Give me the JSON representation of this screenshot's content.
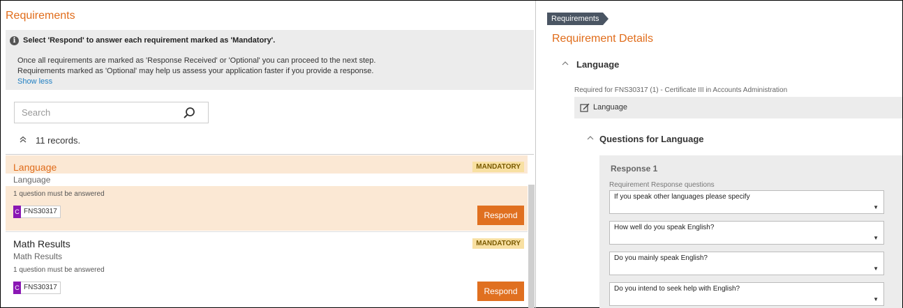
{
  "left": {
    "title": "Requirements",
    "info": {
      "heading": "Select 'Respond' to answer each requirement marked as 'Mandatory'.",
      "line1": "Once all requirements are marked as 'Response Received' or 'Optional' you can proceed to the next step.",
      "line2": "Requirements marked as 'Optional' may help us assess your application faster if you provide a response.",
      "show_less": "Show less"
    },
    "search": {
      "placeholder": "Search",
      "value": ""
    },
    "records": "11 records.",
    "items": [
      {
        "title": "Language",
        "subtitle": "Language",
        "note": "1 question must be answered",
        "badge": "MANDATORY",
        "tag_letter": "C",
        "tag_code": "FNS30317",
        "action": "Respond"
      },
      {
        "title": "Math Results",
        "subtitle": "Math Results",
        "note": "1 question must be answered",
        "badge": "MANDATORY",
        "tag_letter": "C",
        "tag_code": "FNS30317",
        "action": "Respond"
      }
    ]
  },
  "right": {
    "breadcrumb": "Requirements",
    "title": "Requirement Details",
    "section": "Language",
    "required_for": "Required for FNS30317 (1) - Certificate III in Accounts Administration",
    "language_item": "Language",
    "questions_title": "Questions for Language",
    "response_title": "Response 1",
    "response_sub": "Requirement Response questions",
    "questions": [
      "If you speak other languages please specify",
      "How well do you speak English?",
      "Do you mainly speak English?",
      "Do you intend to seek help with English?"
    ]
  },
  "colors": {
    "accent_orange": "#e06c1a",
    "button_orange": "#e07020",
    "badge_bg": "#f8e0a2",
    "selected_row": "#fbe8d4",
    "tag_purple": "#8a17b4",
    "link_blue": "#1f7fc2",
    "breadcrumb_bg": "#4a5563"
  },
  "icons": [
    "info-icon",
    "search-icon",
    "double-chevron-up-icon",
    "chevron-up-icon",
    "edit-icon",
    "dropdown-arrow-icon"
  ]
}
